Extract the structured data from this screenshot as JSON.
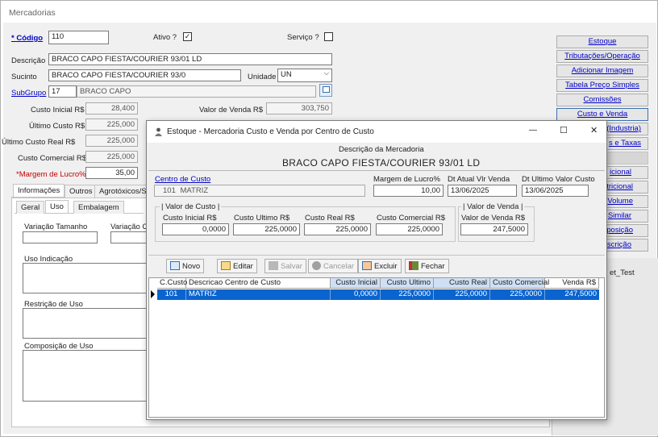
{
  "window": {
    "title": "Mercadorias"
  },
  "form": {
    "codigo_label": "* Código",
    "codigo_value": "110",
    "ativo_label": "Ativo ?",
    "ativo_checked": "✓",
    "servico_label": "Serviço ?",
    "descricao_label": "Descrição",
    "descricao_value": "BRACO CAPO FIESTA/COURIER 93/01 LD",
    "sucinto_label": "Sucinto",
    "sucinto_value": "BRACO CAPO FIESTA/COURIER 93/0",
    "unidade_label": "Unidade",
    "unidade_value": "UN",
    "subgrupo_label": "SubGrupo",
    "subgrupo_code": "17",
    "subgrupo_name": "BRACO CAPO",
    "custo_inicial_label": "Custo Inicial R$",
    "custo_inicial_value": "28,400",
    "ultimo_custo_label": "Último Custo R$",
    "ultimo_custo_value": "225,000",
    "ultimo_custo_real_label": "Último Custo Real R$",
    "ultimo_custo_real_value": "225,000",
    "custo_comercial_label": "Custo Comercial R$",
    "custo_comercial_value": "225,000",
    "margem_label": "*Margem de Lucro%",
    "margem_value": "35,00",
    "valor_venda_label": "Valor de Venda R$",
    "valor_venda_value": "303,750"
  },
  "tabs": {
    "informacoes": "Informações",
    "outros": "Outros",
    "agrotoxicos": "Agrotóxicos/Se"
  },
  "subtabs": {
    "geral": "Geral",
    "uso": "Uso",
    "embalagem": "Embalagem"
  },
  "uso": {
    "variacao_tamanho": "Variação Tamanho",
    "variacao_c": "Variação C",
    "uso_indicacao": "Uso Indicação",
    "restricao": "Restrição de Uso",
    "composicao": "Composição de Uso"
  },
  "sidebar": {
    "items": [
      "Estoque",
      "Tributações/Operação",
      "Adicionar Imagem",
      "Tabela Preço Simples",
      "Comissões",
      "Custo e Venda",
      "(Industria)",
      "s e Taxas",
      "icional",
      "tricional",
      "Volume",
      "Similar",
      "posição",
      "scrição"
    ],
    "bottom_label": "et_Test"
  },
  "modal": {
    "title": "Estoque - Mercadoria Custo e Venda por Centro de Custo",
    "minimize": "—",
    "maximize": "☐",
    "close": "✕",
    "descricao_header": "Descrição da Mercadoria",
    "descricao_value": "BRACO CAPO FIESTA/COURIER 93/01 LD",
    "centro_label": "Centro de Custo",
    "centro_code": "101",
    "centro_name": "MATRIZ",
    "margem_label": "Margem de Lucro%",
    "margem_value": "10,00",
    "dt_venda_label": "Dt Atual Vlr Venda",
    "dt_venda_value": "13/06/2025",
    "dt_custo_label": "Dt Ultimo Valor Custo",
    "dt_custo_value": "13/06/2025",
    "valor_custo_group": "| Valor de Custo |",
    "custo_inicial_label": "Custo Inicial R$",
    "custo_inicial_value": "0,0000",
    "custo_ultimo_label": "Custo Ultimo R$",
    "custo_ultimo_value": "225,0000",
    "custo_real_label": "Custo Real R$",
    "custo_real_value": "225,0000",
    "custo_comercial_label": "Custo Comercial R$",
    "custo_comercial_value": "225,0000",
    "valor_venda_group": "| Valor de Venda |",
    "valor_venda_label": "Valor de Venda R$",
    "valor_venda_value": "247,5000",
    "toolbar": {
      "novo": "Novo",
      "editar": "Editar",
      "salvar": "Salvar",
      "cancelar": "Cancelar",
      "excluir": "Excluir",
      "fechar": "Fechar"
    },
    "grid": {
      "headers": [
        "C.Custo",
        "Descricao Centro de Custo",
        "Custo Inicial",
        "Custo Ultimo",
        "Custo Real",
        "Custo Comercial",
        "Venda R$"
      ],
      "rows": [
        [
          "101",
          "MATRIZ",
          "0,0000",
          "225,0000",
          "225,0000",
          "225,0000",
          "247,5000"
        ]
      ]
    }
  },
  "colors": {
    "selection": "#0a64cf",
    "link": "#0000c8",
    "required": "#c00000"
  }
}
